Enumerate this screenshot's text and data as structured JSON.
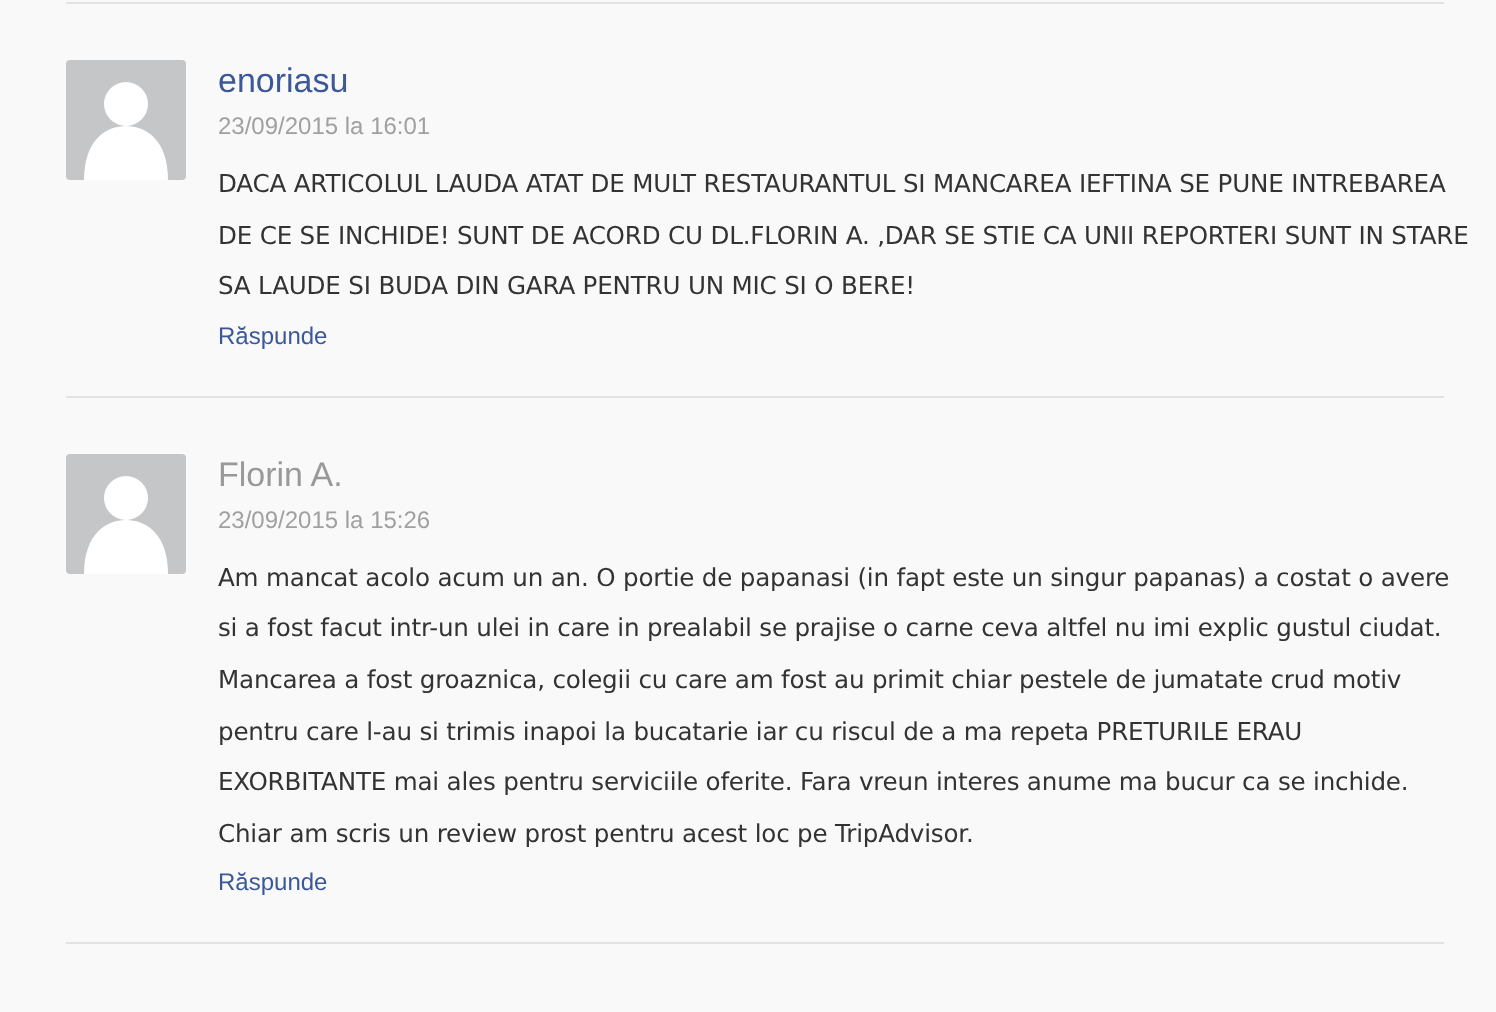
{
  "comments": [
    {
      "author": "enoriasu",
      "linked": true,
      "date": "23/09/2015 la 16:01",
      "text": "DACA ARTICOLUL LAUDA ATAT DE MULT RESTAURANTUL SI MANCAREA IEFTINA SE PUNE INTREBAREA DE CE SE INCHIDE! SUNT DE ACORD CU DL.FLORIN A. ,DAR SE STIE CA UNII REPORTERI SUNT IN STARE SA LAUDE SI BUDA DIN GARA PENTRU UN MIC SI O BERE!",
      "reply": "Răspunde"
    },
    {
      "author": "Florin A.",
      "linked": false,
      "date": "23/09/2015 la 15:26",
      "text": "Am mancat acolo acum un an. O portie de papanasi (in fapt este un singur papanas) a costat o avere si a fost facut intr-un ulei in care in prealabil se prajise o carne ceva altfel nu imi explic gustul ciudat. Mancarea a fost groaznica, colegii cu care am fost au primit chiar pestele de jumatate crud motiv pentru care l-au si trimis inapoi la bucatarie iar cu riscul de a ma repeta PRETURILE ERAU EXORBITANTE mai ales pentru serviciile oferite. Fara vreun interes anume ma bucur ca se inchide. Chiar am scris un review prost pentru acest loc pe TripAdvisor.",
      "reply": "Răspunde"
    }
  ]
}
